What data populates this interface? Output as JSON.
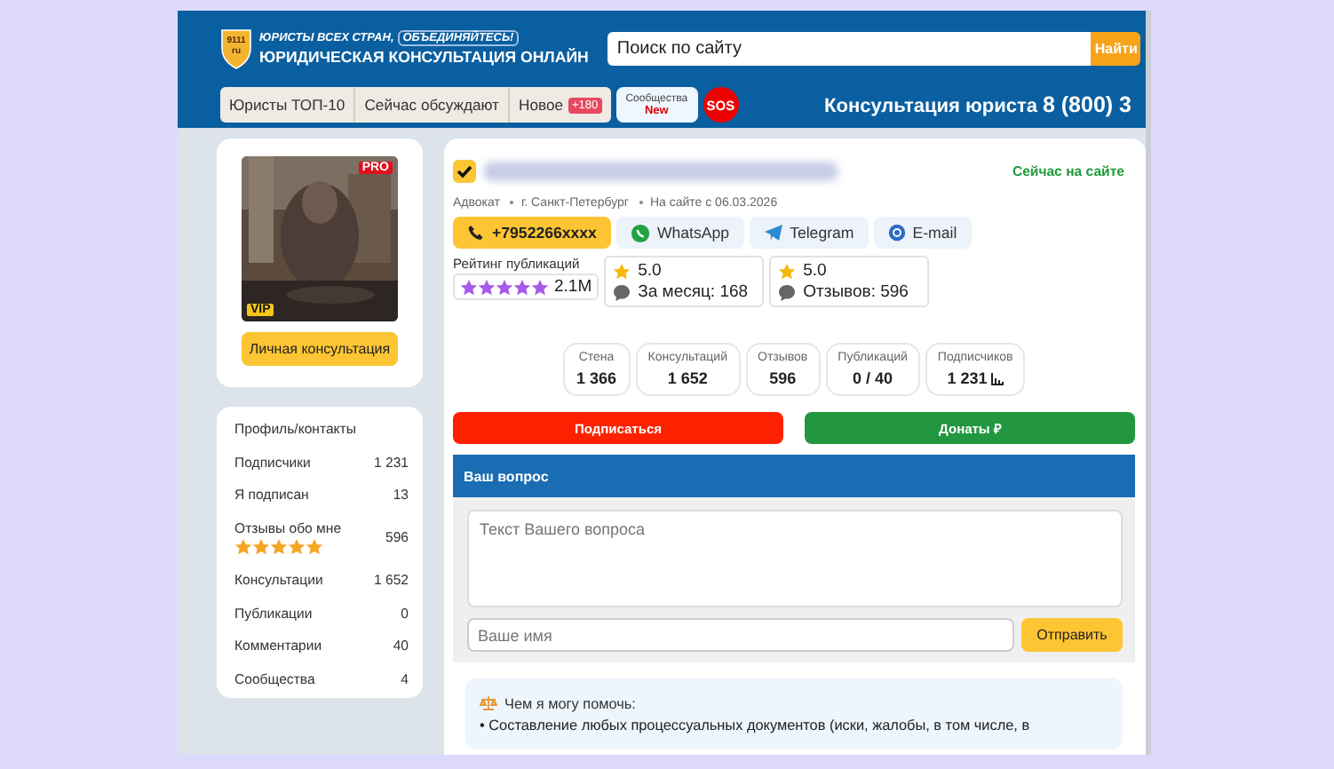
{
  "header": {
    "logo_badge": [
      "9111",
      "ru"
    ],
    "slogan_parts": [
      "ЮРИСТЫ ВСЕХ СТРАН,",
      "ОБЪЕДИНЯЙТЕСЬ!"
    ],
    "site_title": "ЮРИДИЧЕСКАЯ КОНСУЛЬТАЦИЯ ОНЛАЙН",
    "search": {
      "value": "Поиск по сайту",
      "button": "Найти"
    },
    "nav": [
      {
        "label": "Юристы ТОП-10"
      },
      {
        "label": "Сейчас обсуждают"
      },
      {
        "label": "Новое",
        "badge": "+180"
      }
    ],
    "communities": {
      "label": "Сообщества",
      "badge": "New"
    },
    "sos": "SOS",
    "hotline": {
      "label": "Консультация юриста",
      "phone": "8 (800) 3"
    }
  },
  "profile_card": {
    "pro_badge": "PRO",
    "vip_badge": "VIP",
    "button": "Личная консультация"
  },
  "profile_menu": {
    "title": "Профиль/контакты",
    "items": [
      {
        "label": "Подписчики",
        "value": "1 231"
      },
      {
        "label": "Я подписан",
        "value": "13"
      },
      {
        "label": "Отзывы обо мне",
        "value": "596",
        "stars": 5
      },
      {
        "label": "Консультации",
        "value": "1 652"
      },
      {
        "label": "Публикации",
        "value": "0"
      },
      {
        "label": "Комментарии",
        "value": "40"
      },
      {
        "label": "Сообщества",
        "value": "4"
      }
    ]
  },
  "lawyer": {
    "status": "Сейчас на сайте",
    "meta": [
      "Адвокат",
      "г. Санкт-Петербург",
      "На сайте с 06.03.2026"
    ],
    "contacts": [
      {
        "kind": "phone",
        "label": "+7952266xxxx"
      },
      {
        "kind": "whatsapp",
        "label": "WhatsApp"
      },
      {
        "kind": "telegram",
        "label": "Telegram"
      },
      {
        "kind": "email",
        "label": "E-mail"
      }
    ],
    "publication_rating": {
      "label": "Рейтинг публикаций",
      "stars": 5,
      "value": "2.1M"
    },
    "ratings": [
      {
        "score": "5.0",
        "caption": "За месяц: 168"
      },
      {
        "score": "5.0",
        "caption": "Отзывов: 596"
      }
    ],
    "counters": [
      {
        "label": "Стена",
        "value": "1 366"
      },
      {
        "label": "Консультаций",
        "value": "1 652"
      },
      {
        "label": "Отзывов",
        "value": "596"
      },
      {
        "label": "Публикаций",
        "value": "0 / 40"
      },
      {
        "label": "Подписчиков",
        "value": "1 231",
        "chart_icon": true
      }
    ],
    "actions": [
      {
        "kind": "subscribe",
        "label": "Подписаться"
      },
      {
        "kind": "donate",
        "label": "Донаты ₽"
      }
    ]
  },
  "question_form": {
    "title": "Ваш вопрос",
    "question": {
      "placeholder": "Текст Вашего вопроса"
    },
    "name": {
      "placeholder": "Ваше имя"
    },
    "submit": "Отправить"
  },
  "help": {
    "title": "Чем я могу помочь:",
    "items": [
      "• Составление любых процессуальных документов (иски, жалобы, в том числе, в"
    ]
  }
}
